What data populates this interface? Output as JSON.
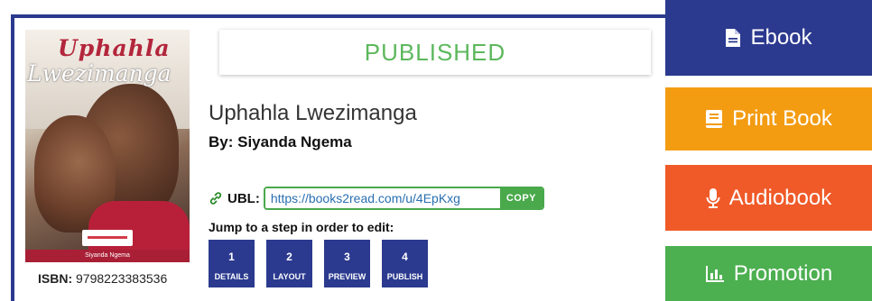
{
  "status": "PUBLISHED",
  "book": {
    "title": "Uphahla Lwezimanga",
    "author": "By: Siyanda Ngema",
    "isbn_label": "ISBN:",
    "isbn_value": "9798223383536"
  },
  "cover": {
    "title_line1": "Uphahla",
    "title_line2": "Lwezimanga",
    "author": "Siyanda Ngema"
  },
  "ubl": {
    "label": "UBL:",
    "value": "https://books2read.com/u/4EpKxg",
    "copy_label": "COPY"
  },
  "jump_text": "Jump to a step in order to edit:",
  "steps": [
    {
      "num": "1",
      "label": "DETAILS"
    },
    {
      "num": "2",
      "label": "LAYOUT"
    },
    {
      "num": "3",
      "label": "PREVIEW"
    },
    {
      "num": "4",
      "label": "PUBLISH"
    }
  ],
  "side_buttons": [
    {
      "label": "Ebook",
      "icon": "file-icon",
      "color": "#2b3a8f"
    },
    {
      "label": "Print Book",
      "icon": "book-icon",
      "color": "#f39c12"
    },
    {
      "label": "Audiobook",
      "icon": "microphone-icon",
      "color": "#f05a28"
    },
    {
      "label": "Promotion",
      "icon": "bar-chart-icon",
      "color": "#4caf50"
    }
  ],
  "colors": {
    "brand": "#2b3a8f",
    "published_green": "#5cb85c",
    "ubl_green": "#49a94b"
  }
}
